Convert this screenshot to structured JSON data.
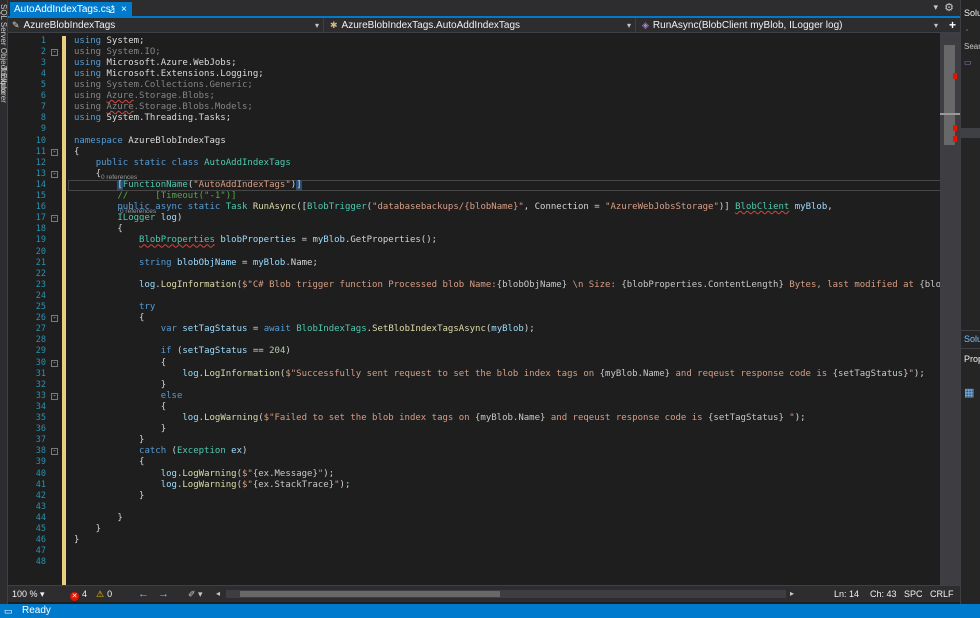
{
  "tab": {
    "title": "AutoAddIndexTags.cs*",
    "pin": "⊿",
    "close": "×"
  },
  "tabbar": {
    "dropdown": "▾",
    "settings": "⚙"
  },
  "left_strip": {
    "item1": "SQL Server Object Explorer",
    "item2": "Toolbox"
  },
  "navbar": {
    "project": "AzureBlobIndexTags",
    "type": "AzureBlobIndexTags.AutoAddIndexTags",
    "member": "RunAsync(BlobClient myBlob, ILogger log)",
    "expand": "+"
  },
  "code_lens": {
    "class_refs": "0 references",
    "method_refs": "0 references"
  },
  "lines": [
    "1",
    "2",
    "3",
    "4",
    "5",
    "6",
    "7",
    "8",
    "9",
    "10",
    "11",
    "12",
    "13",
    "14",
    "15",
    "16",
    "17",
    "18",
    "19",
    "20",
    "21",
    "22",
    "23",
    "24",
    "25",
    "26",
    "27",
    "28",
    "29",
    "30",
    "31",
    "32",
    "33",
    "34",
    "35",
    "36",
    "37",
    "38",
    "39",
    "40",
    "41",
    "42",
    "43",
    "44",
    "45",
    "46",
    "47",
    "48"
  ],
  "bottom": {
    "zoom": "100 %",
    "errors": "4",
    "warnings": "0",
    "line": "Ln: 14",
    "col": "Ch: 43",
    "whitespace": "SPC",
    "eol": "CRLF"
  },
  "status": {
    "text": "Ready"
  },
  "right_panel": {
    "title": "Solution Explorer",
    "search": "Search Solution Explorer",
    "tab": "Solution Explorer",
    "properties": "Properties"
  },
  "colors": {
    "accent": "#007acc",
    "keyword": "#569cd6",
    "type": "#4ec9b0",
    "string": "#d69d85",
    "comment": "#57a64a",
    "error": "#e51400"
  }
}
